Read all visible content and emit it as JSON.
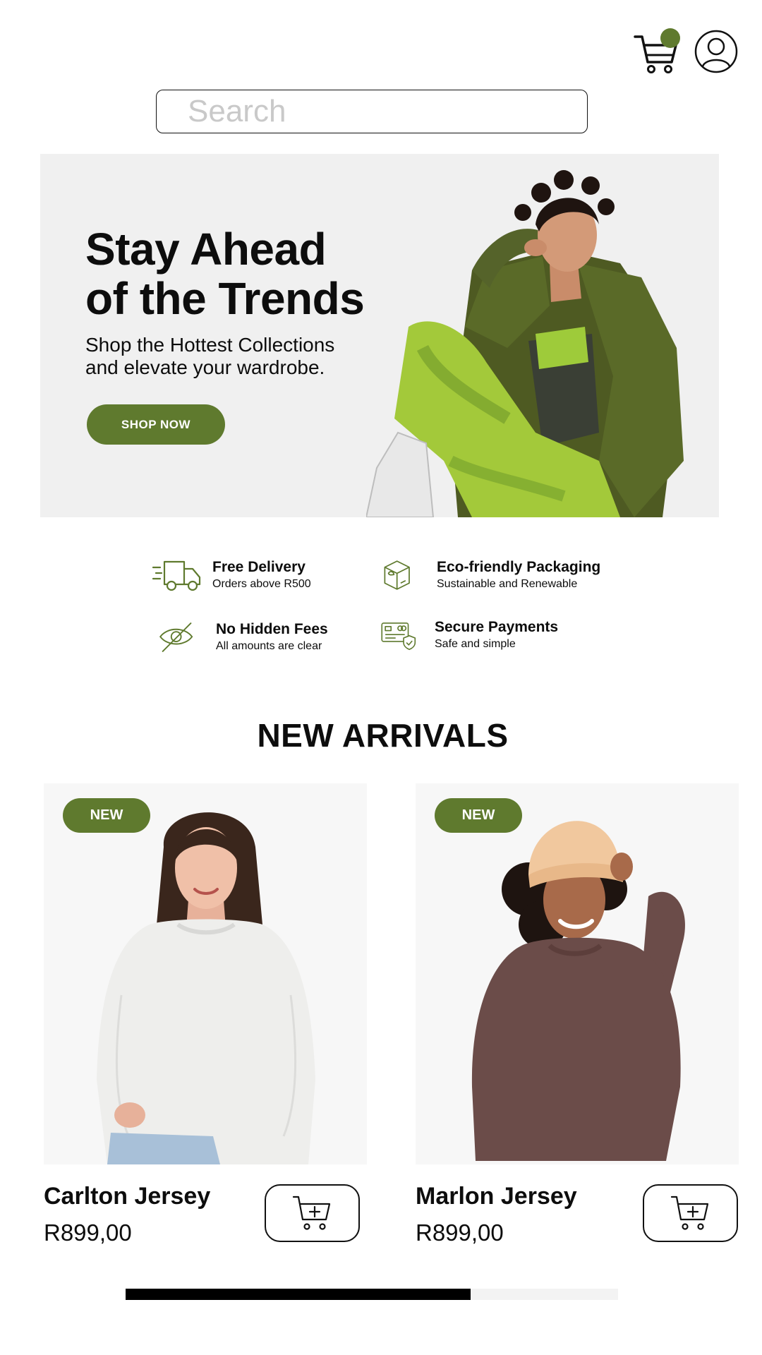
{
  "header": {
    "cart_icon": "cart-icon",
    "cart_badge_color": "#5f7a2e",
    "profile_icon": "user-icon"
  },
  "search": {
    "placeholder": "Search",
    "value": "",
    "search_icon": "search-icon",
    "clear_icon": "close-icon"
  },
  "hero": {
    "title_line1": "Stay Ahead",
    "title_line2": "of the Trends",
    "subtitle_line1": "Shop the Hottest Collections",
    "subtitle_line2": "and elevate your wardrobe.",
    "cta_label": "SHOP NOW"
  },
  "features": [
    {
      "icon": "truck-icon",
      "title": "Free Delivery",
      "subtitle": "Orders above R500"
    },
    {
      "icon": "package-icon",
      "title": "Eco-friendly Packaging",
      "subtitle": "Sustainable and Renewable"
    },
    {
      "icon": "eye-off-icon",
      "title": "No Hidden Fees",
      "subtitle": "All amounts are clear"
    },
    {
      "icon": "credit-card-icon",
      "title": "Secure Payments",
      "subtitle": "Safe and simple"
    }
  ],
  "new_arrivals": {
    "title": "NEW ARRIVALS",
    "products": [
      {
        "badge": "NEW",
        "name": "Carlton Jersey",
        "price": "R899,00",
        "add_icon": "add-to-cart-icon"
      },
      {
        "badge": "NEW",
        "name": "Marlon Jersey",
        "price": "R899,00",
        "add_icon": "add-to-cart-icon"
      }
    ]
  },
  "carousel": {
    "progress": 0.7
  },
  "colors": {
    "accent": "#5f7a2e",
    "hero_bg": "#f0f0f0",
    "card_bg": "#f7f7f7"
  }
}
